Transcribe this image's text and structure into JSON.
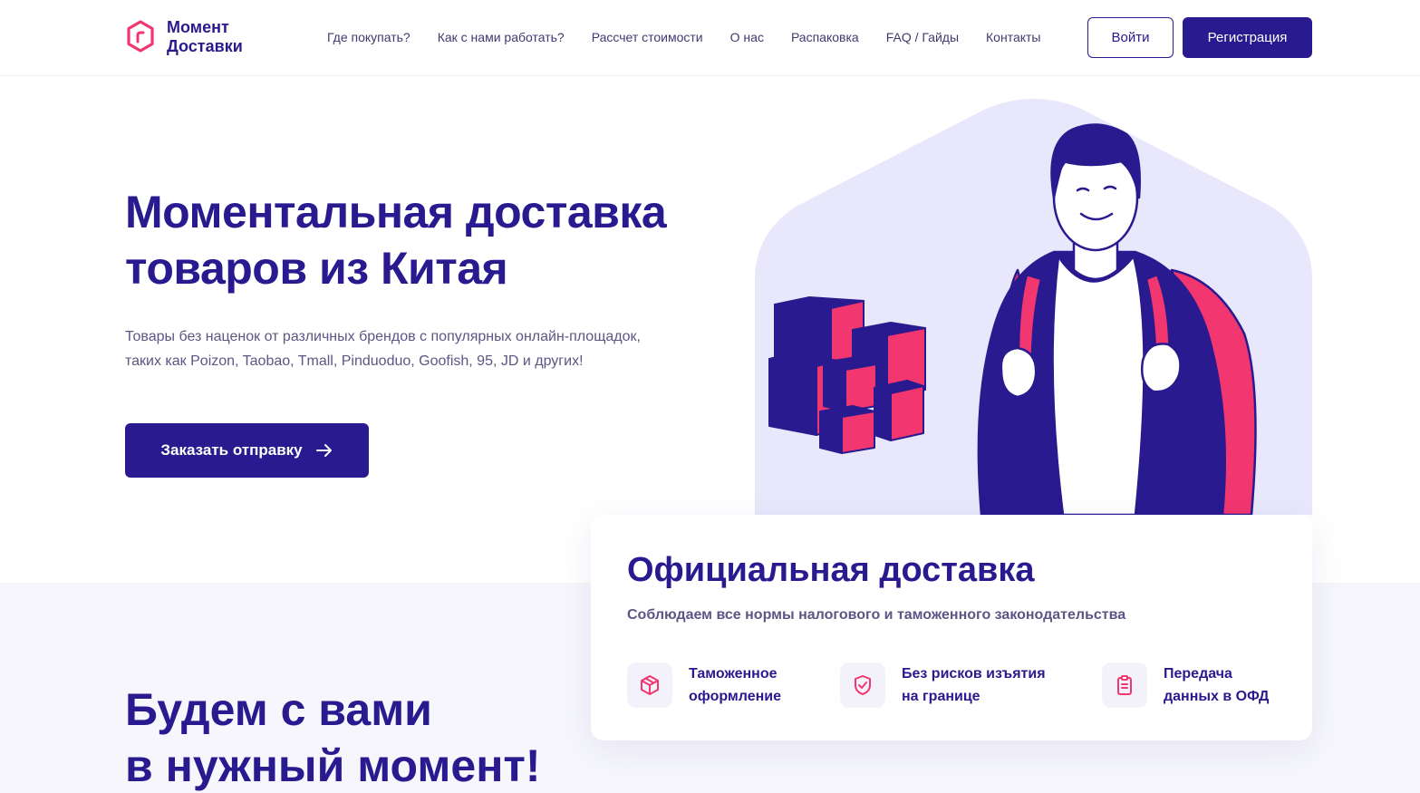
{
  "brand": {
    "line1": "Момент",
    "line2": "Доставки",
    "accent_color": "#f2366f",
    "primary_color": "#2a1a8f"
  },
  "nav": {
    "items": [
      {
        "label": "Где покупать?"
      },
      {
        "label": "Как с нами работать?"
      },
      {
        "label": "Рассчет стоимости"
      },
      {
        "label": "О нас"
      },
      {
        "label": "Распаковка"
      },
      {
        "label": "FAQ / Гайды"
      },
      {
        "label": "Контакты"
      }
    ]
  },
  "auth": {
    "login_label": "Войти",
    "register_label": "Регистрация"
  },
  "hero": {
    "title_line1": "Моментальная доставка",
    "title_line2": "товаров из Китая",
    "description": "Товары без наценок от различных брендов с популярных онлайн-площадок, таких как Poizon, Taobao, Tmall, Pinduoduo, Goofish, 95, JD и других!",
    "cta_label": "Заказать отправку",
    "cta_icon": "arrow-right-icon"
  },
  "official": {
    "title": "Официальная доставка",
    "subtitle": "Соблюдаем все нормы налогового и таможенного законодательства",
    "features": [
      {
        "icon": "box-icon",
        "line1": "Таможенное",
        "line2": "оформление"
      },
      {
        "icon": "shield-check-icon",
        "line1": "Без рисков изъятия",
        "line2": "на границе"
      },
      {
        "icon": "clipboard-icon",
        "line1": "Передача",
        "line2": "данных в ОФД"
      }
    ]
  },
  "section": {
    "title_line1": "Будем с вами",
    "title_line2": "в нужный момент!"
  }
}
